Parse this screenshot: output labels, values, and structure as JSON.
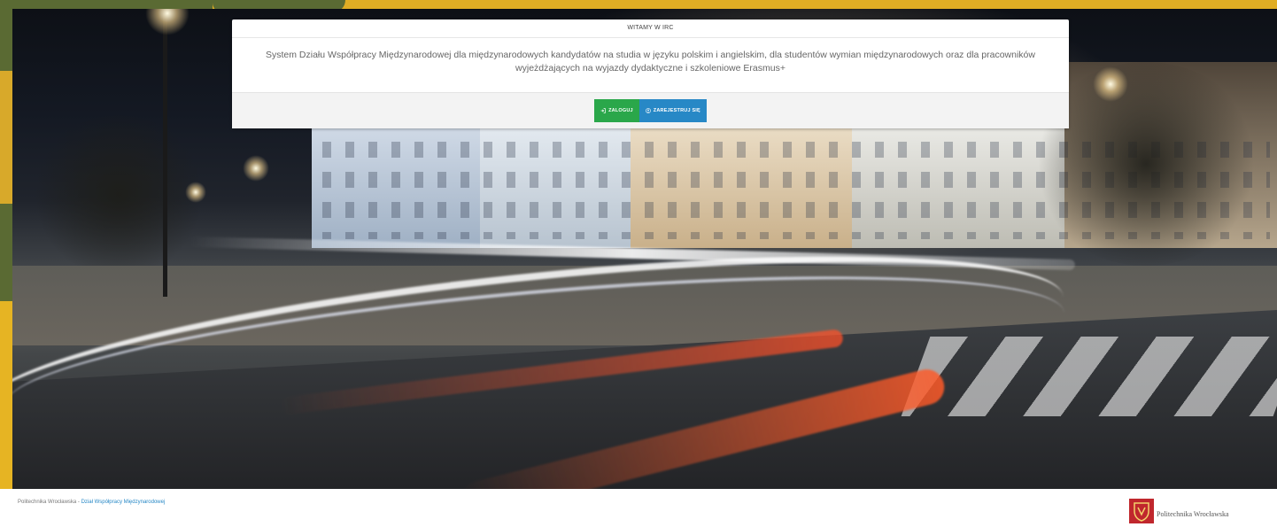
{
  "panel": {
    "title": "WITAMY W IRC",
    "description": "System Działu Współpracy Międzynarodowej dla międzynarodowych kandydatów na studia w języku polskim i angielskim, dla studentów wymian międzynarodowych oraz dla pracowników wyjeżdżających na wyjazdy dydaktyczne i szkoleniowe Erasmus+",
    "login_label": "ZALOGUJ",
    "register_label": "ZAREJESTRUJ SIĘ",
    "login_icon": "sign-in-icon",
    "register_icon": "user-circle-icon"
  },
  "footer": {
    "org": "Politechnika Wrocławska - ",
    "link": "Dział Współpracy Międzynarodowej",
    "logo_text": "Politechnika Wrocławska"
  },
  "colors": {
    "login_button": "#2aa74a",
    "register_button": "#2788c6",
    "frame_green": "#5a6a33",
    "frame_yellow": "#e0ad24",
    "logo_red": "#c0272d"
  }
}
